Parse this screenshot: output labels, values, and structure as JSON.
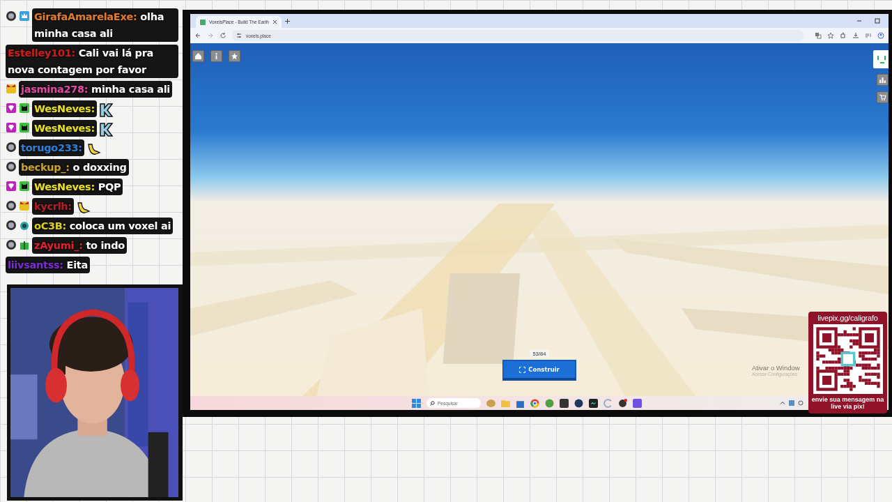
{
  "chat": {
    "messages": [
      {
        "badges": [
          {
            "kind": "disc"
          },
          {
            "kind": "crown"
          }
        ],
        "name": "GirafaAmarelaExe:",
        "color": "#e07a2e",
        "kind": "text",
        "text": "olha minha casa ali"
      },
      {
        "name": "Estelley101:",
        "color": "#d11a1a",
        "kind": "text",
        "text": "Cali vai lá pra nova contagem por favor"
      },
      {
        "badges": [
          {
            "kind": "face"
          }
        ],
        "name": "jasmina278:",
        "color": "#e04aa0",
        "kind": "text",
        "text": "minha casa ali"
      },
      {
        "badges": [
          {
            "kind": "gem"
          },
          {
            "kind": "cat"
          }
        ],
        "name": "WesNeves:",
        "color": "#e8e01a",
        "kind": "letter_emote"
      },
      {
        "badges": [
          {
            "kind": "gem"
          },
          {
            "kind": "cat"
          }
        ],
        "name": "WesNeves:",
        "color": "#e8e01a",
        "kind": "letter_emote"
      },
      {
        "badges": [
          {
            "kind": "disc"
          }
        ],
        "name": "torugo233:",
        "color": "#2f7fd6",
        "kind": "banana_emote"
      },
      {
        "badges": [
          {
            "kind": "disc"
          }
        ],
        "name": "beckup_:",
        "color": "#c9a22a",
        "kind": "text",
        "text": "o doxxing"
      },
      {
        "badges": [
          {
            "kind": "gem"
          },
          {
            "kind": "cat"
          }
        ],
        "name": "WesNeves:",
        "color": "#e8e01a",
        "kind": "text",
        "text": "PQP"
      },
      {
        "badges": [
          {
            "kind": "disc"
          },
          {
            "kind": "face"
          }
        ],
        "name": "kycrlh:",
        "color": "#b0202a",
        "kind": "banana_emote"
      },
      {
        "badges": [
          {
            "kind": "disc"
          },
          {
            "kind": "slime"
          }
        ],
        "name": "oC3B:",
        "color": "#d8d020",
        "kind": "text",
        "text": "coloca um voxel ai"
      },
      {
        "badges": [
          {
            "kind": "disc"
          },
          {
            "kind": "gift"
          }
        ],
        "name": "zAyumi_:",
        "color": "#e0202a",
        "kind": "text",
        "text": "to indo"
      },
      {
        "name": "liivsantss:",
        "color": "#7a2ad6",
        "kind": "text",
        "text": "Eita"
      }
    ]
  },
  "browser": {
    "tab_title": "VoxelsPlace - Build The Earth",
    "address": "voxels.place"
  },
  "page": {
    "counter": "53/84",
    "build_button": "Construir"
  },
  "activation_notice": {
    "title": "Ativar o Window",
    "subtitle": "Acesse Configurações"
  },
  "taskbar": {
    "search_placeholder": "Pesquisar"
  },
  "donation": {
    "url": "livepix.gg/caligrafo",
    "caption": "envie sua mensagem na live via pix!"
  }
}
